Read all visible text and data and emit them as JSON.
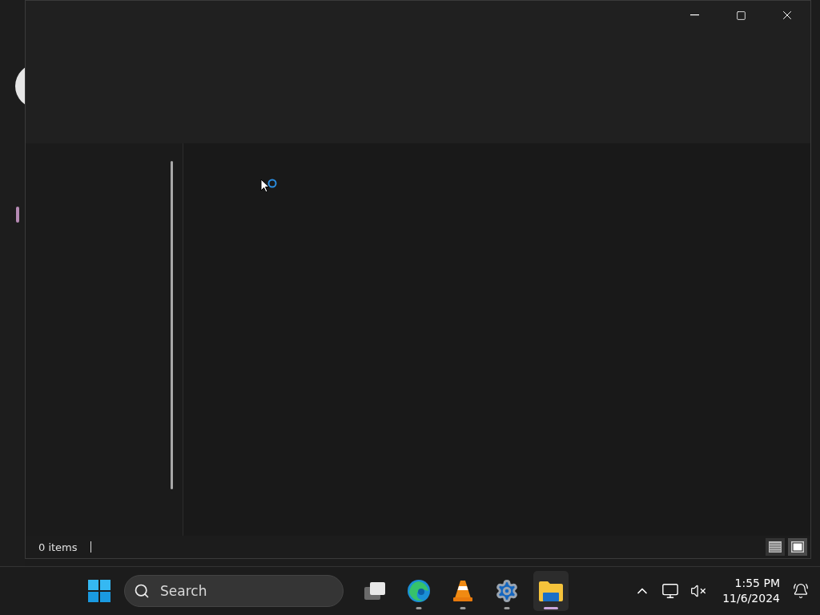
{
  "window": {
    "status_bar": {
      "item_count": "0 items",
      "views": [
        {
          "kind": "details",
          "selected": false
        },
        {
          "kind": "tiles",
          "selected": true
        }
      ]
    }
  },
  "taskbar": {
    "search": {
      "placeholder": "Search"
    },
    "apps": [
      {
        "kind": "taskview",
        "running": false,
        "selected": false
      },
      {
        "kind": "edge",
        "running": true,
        "selected": false
      },
      {
        "kind": "vlc",
        "running": true,
        "selected": false
      },
      {
        "kind": "settings",
        "running": true,
        "selected": false
      },
      {
        "kind": "explorer",
        "running": true,
        "selected": true
      }
    ],
    "clock": {
      "time": "1:55 PM",
      "date": "11/6/2024"
    }
  }
}
